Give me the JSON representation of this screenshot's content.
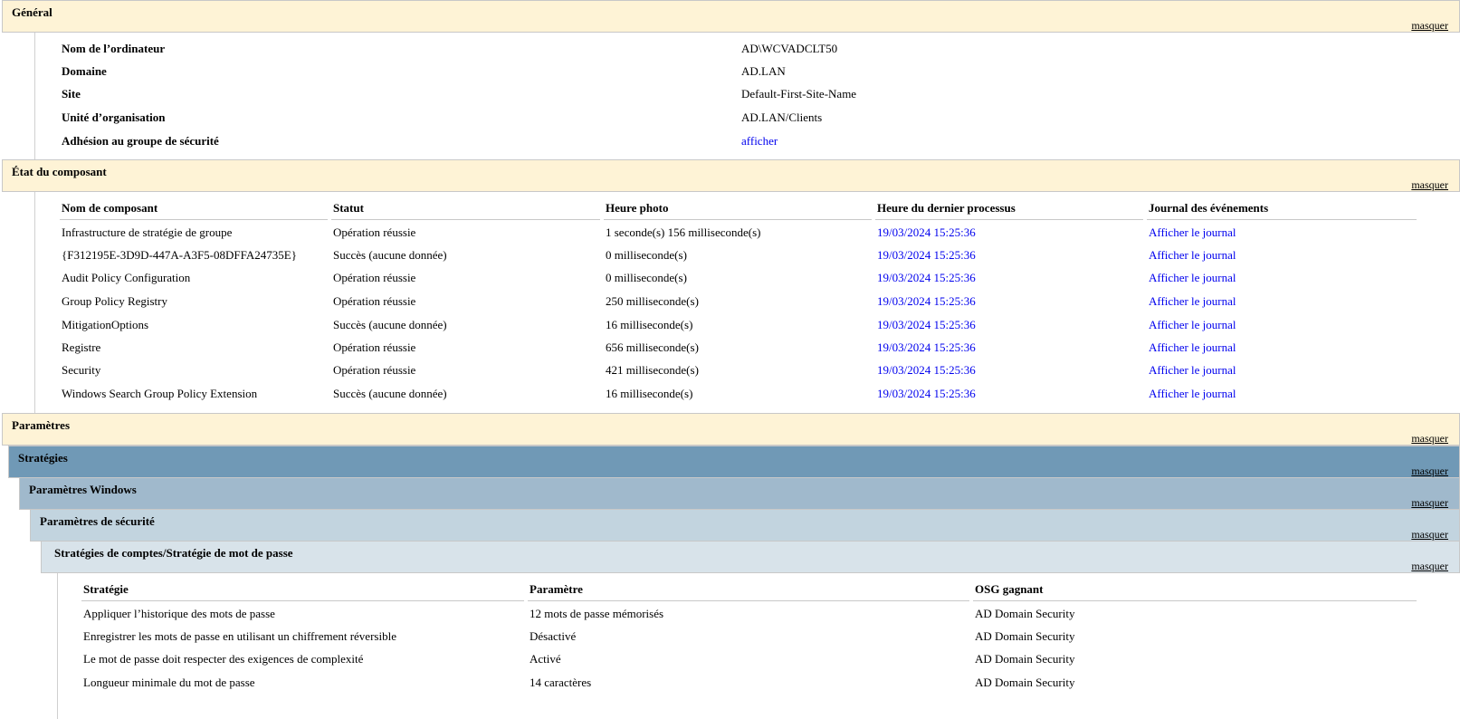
{
  "hide_label": "masquer",
  "general": {
    "title": "Général",
    "rows": [
      {
        "label": "Nom de l’ordinateur",
        "value": "AD\\WCVADCLT50"
      },
      {
        "label": "Domaine",
        "value": "AD.LAN"
      },
      {
        "label": "Site",
        "value": "Default-First-Site-Name"
      },
      {
        "label": "Unité d’organisation",
        "value": "AD.LAN/Clients"
      },
      {
        "label": "Adhésion au groupe de sécurité",
        "value": "afficher"
      }
    ]
  },
  "components": {
    "title": "État du composant",
    "headers": [
      "Nom de composant",
      "Statut",
      "Heure photo",
      "Heure du dernier processus",
      "Journal des événements"
    ],
    "rows": [
      {
        "name": "Infrastructure de stratégie de groupe",
        "status": "Opération réussie",
        "photo": "1 seconde(s) 156 milliseconde(s)",
        "last": "19/03/2024 15:25:36",
        "log": "Afficher le journal"
      },
      {
        "name": "{F312195E-3D9D-447A-A3F5-08DFFA24735E}",
        "status": "Succès (aucune donnée)",
        "photo": "0 milliseconde(s)",
        "last": "19/03/2024 15:25:36",
        "log": "Afficher le journal"
      },
      {
        "name": "Audit Policy Configuration",
        "status": "Opération réussie",
        "photo": "0 milliseconde(s)",
        "last": "19/03/2024 15:25:36",
        "log": "Afficher le journal"
      },
      {
        "name": "Group Policy Registry",
        "status": "Opération réussie",
        "photo": "250 milliseconde(s)",
        "last": "19/03/2024 15:25:36",
        "log": "Afficher le journal"
      },
      {
        "name": "MitigationOptions",
        "status": "Succès (aucune donnée)",
        "photo": "16 milliseconde(s)",
        "last": "19/03/2024 15:25:36",
        "log": "Afficher le journal"
      },
      {
        "name": "Registre",
        "status": "Opération réussie",
        "photo": "656 milliseconde(s)",
        "last": "19/03/2024 15:25:36",
        "log": "Afficher le journal"
      },
      {
        "name": "Security",
        "status": "Opération réussie",
        "photo": "421 milliseconde(s)",
        "last": "19/03/2024 15:25:36",
        "log": "Afficher le journal"
      },
      {
        "name": "Windows Search Group Policy Extension",
        "status": "Succès (aucune donnée)",
        "photo": "16 milliseconde(s)",
        "last": "19/03/2024 15:25:36",
        "log": "Afficher le journal"
      }
    ]
  },
  "settings": {
    "title": "Paramètres",
    "policies_title": "Stratégies",
    "windows_title": "Paramètres Windows",
    "security_title": "Paramètres de sécurité",
    "password_title": "Stratégies de comptes/Stratégie de mot de passe",
    "headers": [
      "Stratégie",
      "Paramètre",
      "OSG gagnant"
    ],
    "rows": [
      {
        "policy": "Appliquer l’historique des mots de passe",
        "setting": "12 mots de passe mémorisés",
        "gpo": "AD Domain Security"
      },
      {
        "policy": "Enregistrer les mots de passe en utilisant un chiffrement réversible",
        "setting": "Désactivé",
        "gpo": "AD Domain Security"
      },
      {
        "policy": "Le mot de passe doit respecter des exigences de complexité",
        "setting": "Activé",
        "gpo": "AD Domain Security"
      },
      {
        "policy": "Longueur minimale du mot de passe",
        "setting": "14 caractères",
        "gpo": "AD Domain Security"
      }
    ]
  }
}
